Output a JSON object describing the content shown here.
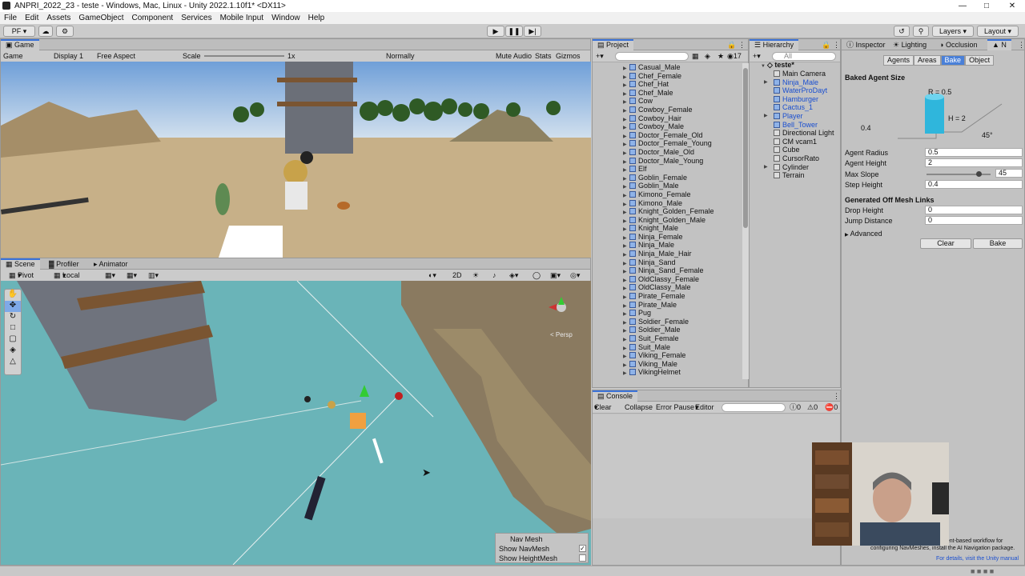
{
  "window": {
    "title": "ANPRI_2022_23 - teste - Windows, Mac, Linux - Unity 2022.1.10f1* <DX11>"
  },
  "menu": [
    "File",
    "Edit",
    "Assets",
    "GameObject",
    "Component",
    "Services",
    "Mobile Input",
    "Window",
    "Help"
  ],
  "toolbar": {
    "account": "PF",
    "layers": "Layers",
    "layout": "Layout"
  },
  "game": {
    "tab": "Game",
    "mode": "Game",
    "display": "Display 1",
    "aspect": "Free Aspect",
    "scale_label": "Scale",
    "scale_value": "1x",
    "play_mode": "Normally",
    "mute": "Mute Audio",
    "stats": "Stats",
    "gizmos": "Gizmos"
  },
  "scene": {
    "tabs": [
      "Scene",
      "Profiler",
      "Animator"
    ],
    "pivot": "Pivot",
    "local": "Local",
    "mode_2d": "2D",
    "persp": "Persp",
    "overlay": {
      "title": "Nav Mesh",
      "show_navmesh": "Show NavMesh",
      "show_heightmesh": "Show HeightMesh",
      "navmesh_checked": true,
      "heightmesh_checked": false
    }
  },
  "project": {
    "tab": "Project",
    "count": "17",
    "items": [
      "Casual_Male",
      "Chef_Female",
      "Chef_Hat",
      "Chef_Male",
      "Cow",
      "Cowboy_Female",
      "Cowboy_Hair",
      "Cowboy_Male",
      "Doctor_Female_Old",
      "Doctor_Female_Young",
      "Doctor_Male_Old",
      "Doctor_Male_Young",
      "Elf",
      "Goblin_Female",
      "Goblin_Male",
      "Kimono_Female",
      "Kimono_Male",
      "Knight_Golden_Female",
      "Knight_Golden_Male",
      "Knight_Male",
      "Ninja_Female",
      "Ninja_Male",
      "Ninja_Male_Hair",
      "Ninja_Sand",
      "Ninja_Sand_Female",
      "OldClassy_Female",
      "OldClassy_Male",
      "Pirate_Female",
      "Pirate_Male",
      "Pug",
      "Soldier_Female",
      "Soldier_Male",
      "Suit_Female",
      "Suit_Male",
      "Viking_Female",
      "Viking_Male",
      "VikingHelmet"
    ]
  },
  "hierarchy": {
    "tab": "Hierarchy",
    "search": "All",
    "scene": "teste*",
    "items": [
      {
        "name": "Main Camera",
        "blue": false,
        "arrow": false
      },
      {
        "name": "Ninja_Male",
        "blue": true,
        "arrow": true
      },
      {
        "name": "WaterProDayt",
        "blue": true,
        "arrow": false
      },
      {
        "name": "Hamburger",
        "blue": true,
        "arrow": false
      },
      {
        "name": "Cactus_1",
        "blue": true,
        "arrow": false
      },
      {
        "name": "Player",
        "blue": true,
        "arrow": true
      },
      {
        "name": "Bell_Tower",
        "blue": true,
        "arrow": false
      },
      {
        "name": "Directional Light",
        "blue": false,
        "arrow": false
      },
      {
        "name": "CM vcam1",
        "blue": false,
        "arrow": false
      },
      {
        "name": "Cube",
        "blue": false,
        "arrow": false
      },
      {
        "name": "CursorRato",
        "blue": false,
        "arrow": false
      },
      {
        "name": "Cylinder",
        "blue": false,
        "arrow": true
      },
      {
        "name": "Terrain",
        "blue": false,
        "arrow": false
      }
    ]
  },
  "inspector": {
    "tabs": [
      "Inspector",
      "Lighting",
      "Occlusion",
      "N"
    ],
    "subtabs": [
      "Agents",
      "Areas",
      "Bake",
      "Object"
    ],
    "baked_title": "Baked Agent Size",
    "diagram": {
      "r": "R = 0.5",
      "h": "H = 2",
      "step": "0.4",
      "angle": "45°"
    },
    "fields": [
      {
        "label": "Agent Radius",
        "value": "0.5"
      },
      {
        "label": "Agent Height",
        "value": "2"
      },
      {
        "label": "Step Height",
        "value": "0.4"
      }
    ],
    "max_slope": {
      "label": "Max Slope",
      "value": "45"
    },
    "offmesh_title": "Generated Off Mesh Links",
    "offmesh": [
      {
        "label": "Drop Height",
        "value": "0"
      },
      {
        "label": "Jump Distance",
        "value": "0"
      }
    ],
    "advanced": "Advanced",
    "clear": "Clear",
    "bake": "Bake",
    "info_a": "nent-based workflow for",
    "info_b": "configuring NavMeshes, install the AI Navigation package.",
    "info_c": "For details, visit the Unity manual"
  },
  "console": {
    "tab": "Console",
    "clear": "Clear",
    "collapse": "Collapse",
    "error_pause": "Error Pause",
    "editor": "Editor",
    "c1": "0",
    "c2": "0",
    "c3": "0"
  }
}
